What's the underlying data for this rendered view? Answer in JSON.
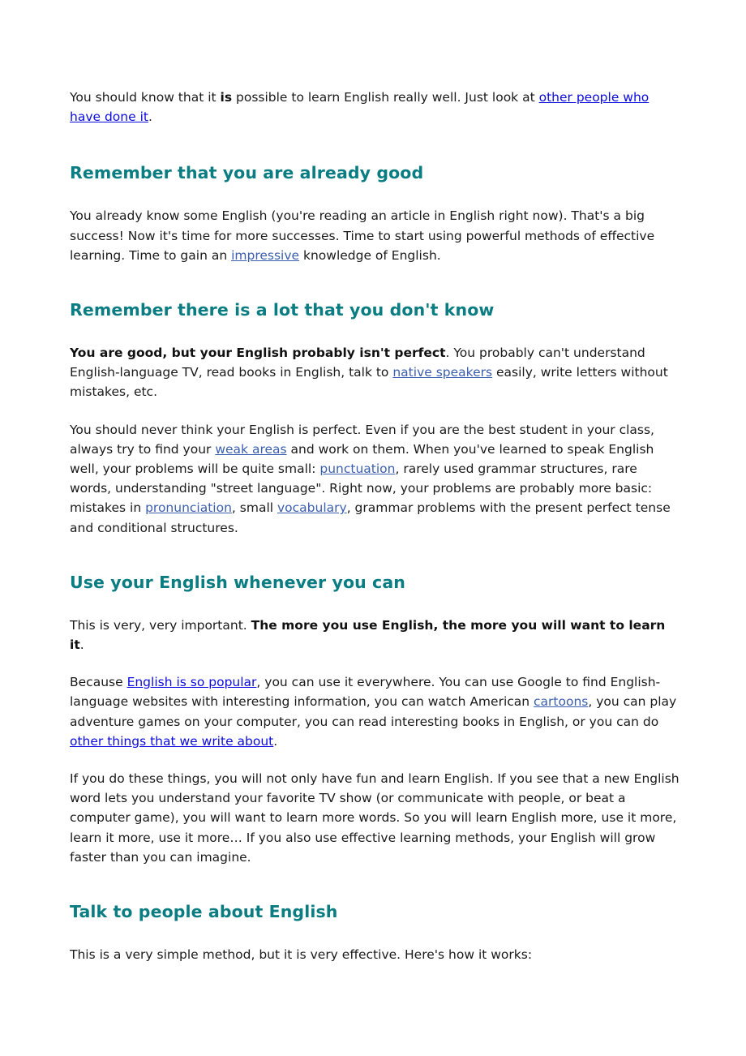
{
  "theme": {
    "heading_color": "#0a7d82",
    "text_color": "#1a1a1a",
    "link_bright_color": "#0b0be0",
    "link_muted_color": "#3b5fae",
    "background": "#ffffff"
  },
  "article": {
    "intro": {
      "t1": "You should know that it ",
      "b1": "is",
      "t2": " possible to learn English really well. Just look at ",
      "link1": "other people who have done it",
      "t3": "."
    },
    "section1": {
      "heading": "Remember that you are already good",
      "p1": {
        "t1": "You already know some English (you're reading an article in English right now). That's a big success! Now it's time for more successes. Time to start using powerful methods of effective learning. Time to gain an ",
        "link1": "impressive",
        "t2": " knowledge of English."
      }
    },
    "section2": {
      "heading": "Remember there is a lot that you don't know",
      "p1": {
        "b1": "You are good, but your English probably isn't perfect",
        "t1": ". You probably can't understand English-language TV, read books in English, talk to ",
        "link1": "native speakers",
        "t2": " easily, write letters without mistakes, etc."
      },
      "p2": {
        "t1": "You should never think your English is perfect. Even if you are the best student in your class, always try to find your ",
        "link1": "weak areas",
        "t2": " and work on them. When you've learned to speak English well, your problems will be quite small: ",
        "link2": "punctuation",
        "t3": ", rarely used grammar structures, rare words, understanding \"street language\". Right now, your problems are probably more basic: mistakes in ",
        "link3": "pronunciation",
        "t4": ", small ",
        "link4": "vocabulary",
        "t5": ", grammar problems with the present perfect tense and conditional structures."
      }
    },
    "section3": {
      "heading": "Use your English whenever you can",
      "p1": {
        "t1": "This is very, very important. ",
        "b1": "The more you use English, the more you will want to learn it",
        "t2": "."
      },
      "p2": {
        "t1": "Because ",
        "link1": "English is so popular",
        "t2": ", you can use it everywhere. You can use Google to find English-language websites with interesting information, you can watch American ",
        "link2": "cartoons",
        "t3": ", you can play adventure games on your computer, you can read interesting books in English, or you can do ",
        "link3": "other things that we write about",
        "t4": "."
      },
      "p3": {
        "t1": "If you do these things, you will not only have fun and learn English. If you see that a new English word lets you understand your favorite TV show (or communicate with people, or beat a computer game), you will want to learn more words. So you will learn English more, use it more, learn it more, use it more… If you also use effective learning methods, your English will grow faster than you can imagine."
      }
    },
    "section4": {
      "heading": "Talk to people about English",
      "p1": {
        "t1": "This is a very simple method, but it is very effective. Here's how it works:"
      }
    }
  }
}
